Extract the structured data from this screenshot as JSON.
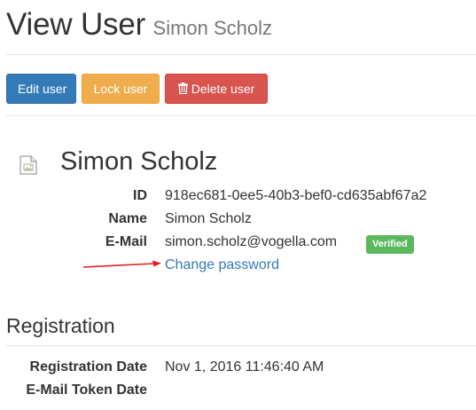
{
  "header": {
    "title": "View User",
    "subtitle": "Simon Scholz"
  },
  "toolbar": {
    "edit_label": "Edit user",
    "lock_label": "Lock user",
    "delete_label": "Delete user",
    "delete_icon": "trash-icon"
  },
  "colors": {
    "primary": "#337ab7",
    "warning": "#f0ad4e",
    "danger": "#d9534f",
    "success": "#5cb85c",
    "annotation_arrow": "#e02020"
  },
  "user": {
    "avatar_icon": "broken-image-icon",
    "name": "Simon Scholz",
    "fields": {
      "id_label": "ID",
      "id_value": "918ec681-0ee5-40b3-bef0-cd635abf67a2",
      "name_label": "Name",
      "name_value": "Simon Scholz",
      "email_label": "E-Mail",
      "email_value": "simon.scholz@vogella.com",
      "verified_badge": "Verified"
    },
    "change_password_link": "Change password",
    "annotation": "red-arrow-pointing-right"
  },
  "registration": {
    "title": "Registration",
    "date_label": "Registration Date",
    "date_value": "Nov 1, 2016 11:46:40 AM",
    "token_label": "E-Mail Token Date",
    "token_value": ""
  }
}
